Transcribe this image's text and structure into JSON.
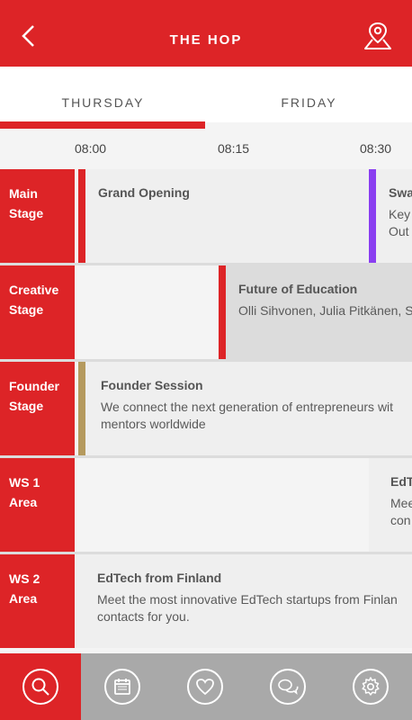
{
  "header": {
    "title": "THE HOP",
    "back_icon": "chevron-left-icon",
    "map_icon": "map-pin-icon"
  },
  "colors": {
    "brand_red": "#dd2427",
    "gold": "#b59a5e",
    "purple": "#8a3ff0",
    "nav_gray": "#a9a9a9"
  },
  "tabs": [
    {
      "label": "THURSDAY",
      "selected": true
    },
    {
      "label": "FRIDAY",
      "selected": false
    }
  ],
  "times": [
    "08:00",
    "08:15",
    "08:30"
  ],
  "stages": [
    {
      "name": "Main\nStage",
      "events": [
        {
          "title": "Grand Opening",
          "desc": ""
        },
        {
          "title": "Swa",
          "desc": "Key\nOut"
        }
      ]
    },
    {
      "name": "Creative\nStage",
      "events": [
        {
          "title": "Future of Education",
          "desc": "Olli Sihvonen, Julia Pitkänen, S"
        }
      ]
    },
    {
      "name": "Founder\nStage",
      "events": [
        {
          "title": "Founder Session",
          "desc": "We connect the next generation of entrepreneurs wit\nmentors worldwide"
        }
      ]
    },
    {
      "name": "WS 1\nArea",
      "events": [
        {
          "title": "EdT",
          "desc": "Mee\ncon"
        }
      ]
    },
    {
      "name": "WS 2\nArea",
      "events": [
        {
          "title": "EdTech from Finland",
          "desc": "Meet the most innovative EdTech startups from Finlan\ncontacts for you."
        }
      ]
    }
  ],
  "bottom_nav": [
    {
      "icon": "search-icon",
      "active": true
    },
    {
      "icon": "calendar-icon",
      "active": false
    },
    {
      "icon": "heart-icon",
      "active": false
    },
    {
      "icon": "chat-icon",
      "active": false
    },
    {
      "icon": "gear-icon",
      "active": false
    }
  ]
}
